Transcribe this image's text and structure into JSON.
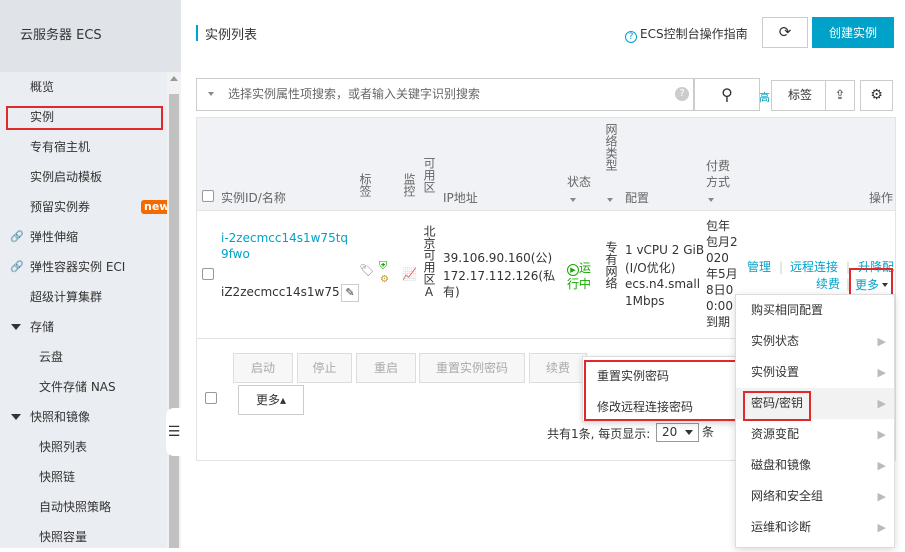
{
  "sidebar": {
    "title": "云服务器 ECS",
    "items": [
      {
        "label": "概览"
      },
      {
        "label": "实例"
      },
      {
        "label": "专有宿主机"
      },
      {
        "label": "实例启动模板"
      },
      {
        "label": "预留实例券",
        "badge": "new"
      },
      {
        "label": "弹性伸缩"
      },
      {
        "label": "弹性容器实例 ECI"
      },
      {
        "label": "超级计算集群"
      },
      {
        "label": "存储"
      },
      {
        "label": "云盘"
      },
      {
        "label": "文件存储 NAS"
      },
      {
        "label": "快照和镜像"
      },
      {
        "label": "快照列表"
      },
      {
        "label": "快照链"
      },
      {
        "label": "自动快照策略"
      },
      {
        "label": "快照容量"
      }
    ]
  },
  "header": {
    "title": "实例列表",
    "guide": "ECS控制台操作指南",
    "create": "创建实例"
  },
  "search": {
    "placeholder": "选择实例属性项搜索，或者输入关键字识别搜索",
    "advanced": "高",
    "tag": "标签"
  },
  "table": {
    "col_id": "实例ID/名称",
    "col_tag": "标签",
    "col_monitor": "监控",
    "col_zone": "可用区",
    "col_ip": "IP地址",
    "col_status": "状态",
    "col_network": "网络类型",
    "col_config": "配置",
    "col_pay": "付费方式",
    "col_action": "操作",
    "row": {
      "id": "i-2zecmcc14s1w75tq9fwo",
      "name": "iZ2zecmcc14s1w75...",
      "zone": "北京可用区A",
      "ip1": "39.106.90.160(公)",
      "ip2": "172.17.112.126(私有)",
      "status": "运行中",
      "network": "专有网络",
      "config1": "1 vCPU 2 GiB",
      "config2": "(I/O优化)",
      "config3": "ecs.n4.small",
      "config4": "1Mbps",
      "pay": "包年包月2020年5月8日00:00到期",
      "manage": "管理",
      "remote": "远程连接",
      "renew": "续费",
      "upgrade": "升降配",
      "more": "更多"
    }
  },
  "toolbar": {
    "start": "启动",
    "stop": "停止",
    "restart": "重启",
    "reset_pw": "重置实例密码",
    "renew": "续费",
    "more": "更多▴",
    "pager_total": "共有1条, 每页显示:",
    "pager_size": "20",
    "pager_unit": "条"
  },
  "password_menu": {
    "items": [
      "重置实例密码",
      "修改远程连接密码"
    ]
  },
  "more_menu": {
    "items": [
      "购买相同配置",
      "实例状态",
      "实例设置",
      "密码/密钥",
      "资源变配",
      "磁盘和镜像",
      "网络和安全组",
      "运维和诊断"
    ]
  },
  "colors": {
    "accent": "#00a2ca",
    "highlight": "#e0292b",
    "running": "#19a600",
    "badge": "#f56a00"
  }
}
